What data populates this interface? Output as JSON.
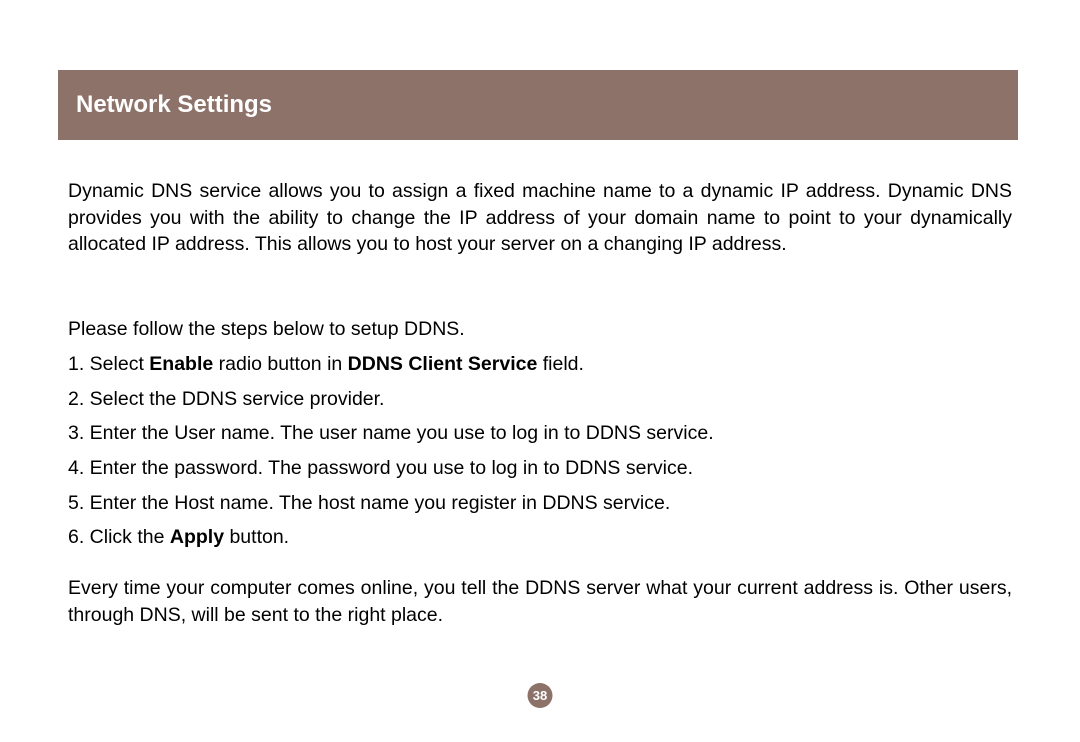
{
  "header": {
    "title": "Network Settings"
  },
  "intro": "Dynamic DNS service allows you to assign a fixed machine name to a dynamic IP address. Dynamic DNS provides you with the ability to change the IP address of your domain name to point to your dynamically allocated IP address. This allows you to host your server on a changing IP address.",
  "followLine": "Please follow the steps below to setup DDNS.",
  "steps": {
    "s1_prefix": "1. Select ",
    "s1_bold1": "Enable",
    "s1_mid": " radio button in ",
    "s1_bold2": "DDNS Client Service",
    "s1_suffix": " field.",
    "s2": "2. Select the DDNS service provider.",
    "s3": "3. Enter the User name. The user name you use to log in to DDNS service.",
    "s4": "4. Enter the password. The password you use to log in to DDNS service.",
    "s5": "5. Enter the Host name. The host name you register in DDNS service.",
    "s6_prefix": "6. Click the ",
    "s6_bold": "Apply",
    "s6_suffix": " button."
  },
  "closing": "Every time your computer comes online, you tell the DDNS server what your current address is. Other users, through DNS, will be sent to the right place.",
  "pageNumber": "38"
}
